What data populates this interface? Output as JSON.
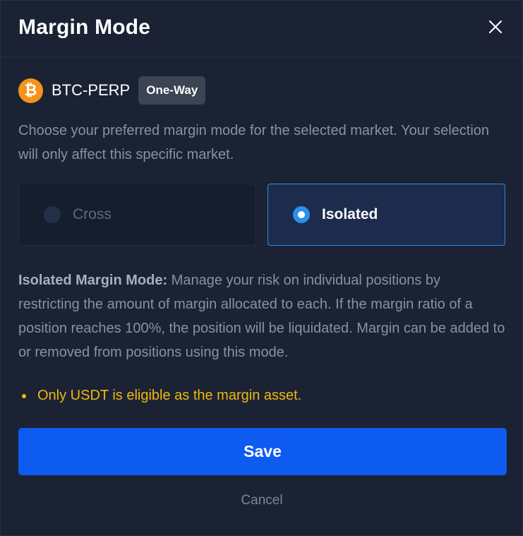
{
  "modal": {
    "title": "Margin Mode",
    "close_icon": "close-icon"
  },
  "market": {
    "coin_icon": "bitcoin-icon",
    "coin_symbol": "₿",
    "name": "BTC-PERP",
    "position_mode": "One-Way"
  },
  "description": "Choose your preferred margin mode for the selected market. Your selection will only affect this specific market.",
  "options": [
    {
      "label": "Cross",
      "selected": false
    },
    {
      "label": "Isolated",
      "selected": true
    }
  ],
  "info": {
    "heading": "Isolated Margin Mode:",
    "text": " Manage your risk on individual positions by restricting the amount of margin allocated to each. If the margin ratio of a position reaches 100%, the position will be liquidated. Margin can be added to or removed from positions using this mode."
  },
  "note": "Only USDT is eligible as the margin asset.",
  "actions": {
    "save_label": "Save",
    "cancel_label": "Cancel"
  },
  "colors": {
    "background": "#1a2233",
    "accent": "#0d5bf0",
    "selected_border": "#2f8de4",
    "warning": "#f0b90b",
    "btc_orange": "#f7931a"
  }
}
